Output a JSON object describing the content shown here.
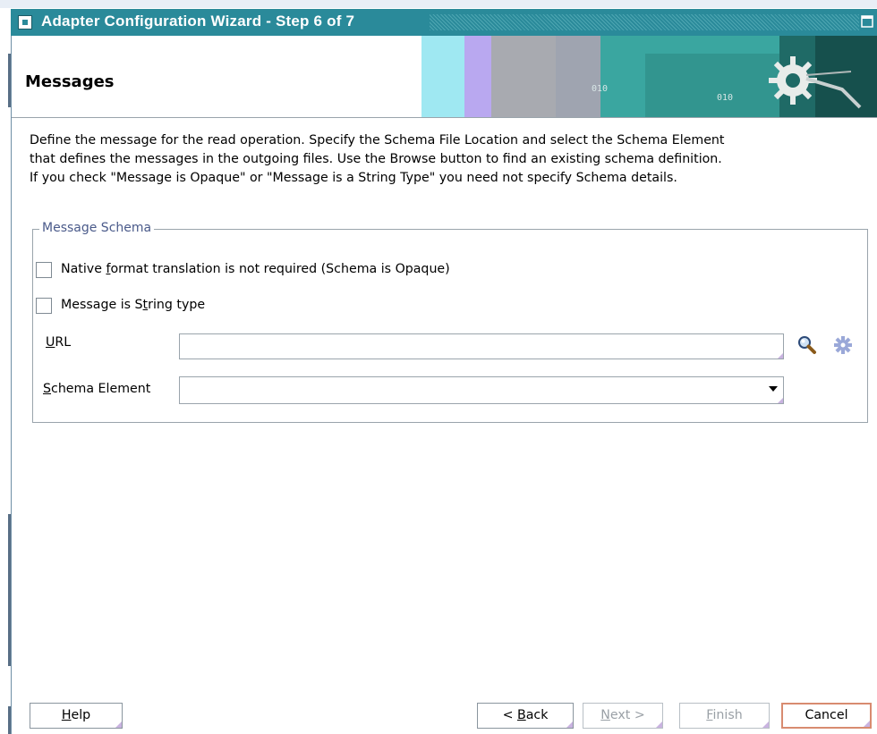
{
  "window": {
    "title": "Adapter Configuration Wizard - Step 6 of 7"
  },
  "header": {
    "title": "Messages",
    "banner_text": "010",
    "banner_text2": "010"
  },
  "description": {
    "line1": "Define the message for the read operation. Specify the Schema File Location and select the Schema Element",
    "line2": "that defines the messages in the outgoing files. Use the Browse button to find an existing schema definition.",
    "line3": "If you check \"Message is Opaque\" or \"Message is a String Type\" you need not specify Schema details."
  },
  "message_schema": {
    "legend": "Message Schema",
    "opaque_checkbox": {
      "label_pre": "Native ",
      "label_mnemonic": "f",
      "label_post": "ormat translation is not required (Schema is Opaque)",
      "checked": false
    },
    "string_checkbox": {
      "label_pre": "Message is S",
      "label_mnemonic": "t",
      "label_post": "ring type",
      "checked": false
    },
    "url": {
      "label_mnemonic": "U",
      "label_post": "RL",
      "value": ""
    },
    "schema_element": {
      "label_mnemonic": "S",
      "label_post": "chema Element",
      "value": ""
    },
    "icons": [
      "search-icon",
      "gear-icon"
    ]
  },
  "footer": {
    "help": {
      "mnemonic": "H",
      "rest": "elp"
    },
    "back": {
      "pre": "< ",
      "mnemonic": "B",
      "rest": "ack"
    },
    "next": {
      "mnemonic": "N",
      "rest": "ext >"
    },
    "finish": {
      "mnemonic": "F",
      "rest": "inish"
    },
    "cancel": "Cancel"
  },
  "colors": {
    "titlebar": "#2a8a9a",
    "legend": "#4a5a8a",
    "default_button_border": "#d88b70"
  }
}
